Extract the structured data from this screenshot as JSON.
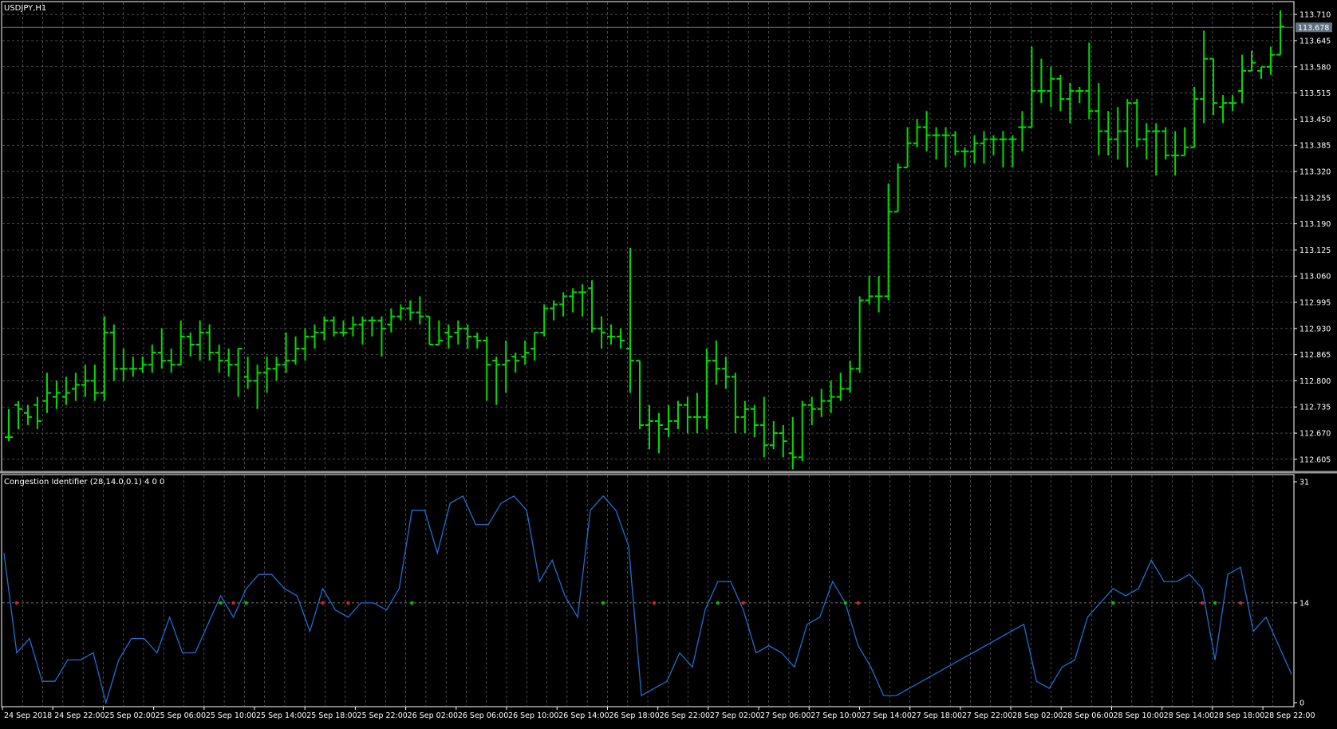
{
  "chart_data": [
    {
      "type": "ohlc",
      "title": "USDJPY,H1",
      "current_price": "113.678",
      "ylim": [
        112.575,
        113.74
      ],
      "y_ticks": [
        "113.710",
        "113.645",
        "113.580",
        "113.515",
        "113.450",
        "113.385",
        "113.320",
        "113.255",
        "113.190",
        "113.125",
        "113.060",
        "112.995",
        "112.930",
        "112.865",
        "112.800",
        "112.735",
        "112.670",
        "112.605"
      ],
      "colors": {
        "background": "#000000",
        "bars": "#00dd00",
        "grid": "#7a7a7a",
        "axis": "#ffffff",
        "price_line": "#607080"
      },
      "bars": [
        {
          "o": 112.66,
          "h": 112.73,
          "l": 112.65,
          "c": 112.66
        },
        {
          "o": 112.74,
          "h": 112.75,
          "l": 112.68,
          "c": 112.73
        },
        {
          "o": 112.72,
          "h": 112.74,
          "l": 112.69,
          "c": 112.71
        },
        {
          "o": 112.74,
          "h": 112.76,
          "l": 112.68,
          "c": 112.7
        },
        {
          "o": 112.75,
          "h": 112.82,
          "l": 112.72,
          "c": 112.77
        },
        {
          "o": 112.76,
          "h": 112.8,
          "l": 112.73,
          "c": 112.77
        },
        {
          "o": 112.76,
          "h": 112.81,
          "l": 112.74,
          "c": 112.77
        },
        {
          "o": 112.78,
          "h": 112.82,
          "l": 112.75,
          "c": 112.79
        },
        {
          "o": 112.79,
          "h": 112.84,
          "l": 112.76,
          "c": 112.8
        },
        {
          "o": 112.8,
          "h": 112.84,
          "l": 112.75,
          "c": 112.77
        },
        {
          "o": 112.77,
          "h": 112.96,
          "l": 112.75,
          "c": 112.92
        },
        {
          "o": 112.92,
          "h": 112.94,
          "l": 112.8,
          "c": 112.83
        },
        {
          "o": 112.83,
          "h": 112.88,
          "l": 112.8,
          "c": 112.83
        },
        {
          "o": 112.83,
          "h": 112.86,
          "l": 112.81,
          "c": 112.83
        },
        {
          "o": 112.83,
          "h": 112.86,
          "l": 112.82,
          "c": 112.84
        },
        {
          "o": 112.84,
          "h": 112.89,
          "l": 112.82,
          "c": 112.87
        },
        {
          "o": 112.87,
          "h": 112.93,
          "l": 112.83,
          "c": 112.85
        },
        {
          "o": 112.85,
          "h": 112.88,
          "l": 112.82,
          "c": 112.84
        },
        {
          "o": 112.84,
          "h": 112.95,
          "l": 112.84,
          "c": 112.91
        },
        {
          "o": 112.91,
          "h": 112.92,
          "l": 112.86,
          "c": 112.89
        },
        {
          "o": 112.89,
          "h": 112.95,
          "l": 112.85,
          "c": 112.92
        },
        {
          "o": 112.92,
          "h": 112.94,
          "l": 112.85,
          "c": 112.87
        },
        {
          "o": 112.87,
          "h": 112.89,
          "l": 112.82,
          "c": 112.85
        },
        {
          "o": 112.85,
          "h": 112.88,
          "l": 112.81,
          "c": 112.84
        },
        {
          "o": 112.84,
          "h": 112.88,
          "l": 112.76,
          "c": 112.88
        },
        {
          "o": 112.81,
          "h": 112.86,
          "l": 112.78,
          "c": 112.8
        },
        {
          "o": 112.8,
          "h": 112.84,
          "l": 112.73,
          "c": 112.82
        },
        {
          "o": 112.82,
          "h": 112.86,
          "l": 112.77,
          "c": 112.83
        },
        {
          "o": 112.83,
          "h": 112.86,
          "l": 112.8,
          "c": 112.84
        },
        {
          "o": 112.84,
          "h": 112.92,
          "l": 112.82,
          "c": 112.85
        },
        {
          "o": 112.85,
          "h": 112.91,
          "l": 112.84,
          "c": 112.88
        },
        {
          "o": 112.88,
          "h": 112.93,
          "l": 112.85,
          "c": 112.91
        },
        {
          "o": 112.91,
          "h": 112.94,
          "l": 112.88,
          "c": 112.92
        },
        {
          "o": 112.92,
          "h": 112.96,
          "l": 112.9,
          "c": 112.95
        },
        {
          "o": 112.95,
          "h": 112.96,
          "l": 112.91,
          "c": 112.92
        },
        {
          "o": 112.92,
          "h": 112.95,
          "l": 112.91,
          "c": 112.92
        },
        {
          "o": 112.93,
          "h": 112.96,
          "l": 112.91,
          "c": 112.94
        },
        {
          "o": 112.94,
          "h": 112.96,
          "l": 112.89,
          "c": 112.95
        },
        {
          "o": 112.95,
          "h": 112.96,
          "l": 112.91,
          "c": 112.95
        },
        {
          "o": 112.95,
          "h": 112.96,
          "l": 112.86,
          "c": 112.93
        },
        {
          "o": 112.94,
          "h": 112.98,
          "l": 112.92,
          "c": 112.96
        },
        {
          "o": 112.96,
          "h": 112.99,
          "l": 112.95,
          "c": 112.98
        },
        {
          "o": 112.98,
          "h": 113.0,
          "l": 112.95,
          "c": 112.97
        },
        {
          "o": 112.97,
          "h": 113.01,
          "l": 112.94,
          "c": 112.96
        },
        {
          "o": 112.96,
          "h": 112.96,
          "l": 112.89,
          "c": 112.89
        },
        {
          "o": 112.89,
          "h": 112.95,
          "l": 112.89,
          "c": 112.9
        },
        {
          "o": 112.92,
          "h": 112.94,
          "l": 112.88,
          "c": 112.91
        },
        {
          "o": 112.92,
          "h": 112.95,
          "l": 112.89,
          "c": 112.93
        },
        {
          "o": 112.93,
          "h": 112.94,
          "l": 112.88,
          "c": 112.91
        },
        {
          "o": 112.91,
          "h": 112.92,
          "l": 112.88,
          "c": 112.9
        },
        {
          "o": 112.9,
          "h": 112.91,
          "l": 112.75,
          "c": 112.84
        },
        {
          "o": 112.85,
          "h": 112.86,
          "l": 112.74,
          "c": 112.84
        },
        {
          "o": 112.84,
          "h": 112.9,
          "l": 112.77,
          "c": 112.85
        },
        {
          "o": 112.86,
          "h": 112.87,
          "l": 112.82,
          "c": 112.85
        },
        {
          "o": 112.86,
          "h": 112.9,
          "l": 112.84,
          "c": 112.87
        },
        {
          "o": 112.88,
          "h": 112.92,
          "l": 112.85,
          "c": 112.92
        },
        {
          "o": 112.92,
          "h": 112.99,
          "l": 112.91,
          "c": 112.98
        },
        {
          "o": 112.98,
          "h": 113.0,
          "l": 112.95,
          "c": 112.99
        },
        {
          "o": 112.99,
          "h": 113.02,
          "l": 112.96,
          "c": 113.01
        },
        {
          "o": 113.01,
          "h": 113.03,
          "l": 112.97,
          "c": 113.02
        },
        {
          "o": 113.02,
          "h": 113.04,
          "l": 112.96,
          "c": 113.02
        },
        {
          "o": 113.03,
          "h": 113.05,
          "l": 112.92,
          "c": 112.93
        },
        {
          "o": 112.93,
          "h": 112.96,
          "l": 112.88,
          "c": 112.92
        },
        {
          "o": 112.91,
          "h": 112.94,
          "l": 112.89,
          "c": 112.91
        },
        {
          "o": 112.91,
          "h": 112.93,
          "l": 112.88,
          "c": 112.9
        },
        {
          "o": 112.88,
          "h": 113.13,
          "l": 112.77,
          "c": 112.85
        },
        {
          "o": 112.85,
          "h": 112.85,
          "l": 112.68,
          "c": 112.69
        },
        {
          "o": 112.69,
          "h": 112.74,
          "l": 112.63,
          "c": 112.7
        },
        {
          "o": 112.7,
          "h": 112.72,
          "l": 112.62,
          "c": 112.69
        },
        {
          "o": 112.68,
          "h": 112.74,
          "l": 112.66,
          "c": 112.7
        },
        {
          "o": 112.7,
          "h": 112.75,
          "l": 112.68,
          "c": 112.74
        },
        {
          "o": 112.74,
          "h": 112.76,
          "l": 112.67,
          "c": 112.71
        },
        {
          "o": 112.71,
          "h": 112.77,
          "l": 112.67,
          "c": 112.71
        },
        {
          "o": 112.71,
          "h": 112.88,
          "l": 112.68,
          "c": 112.85
        },
        {
          "o": 112.85,
          "h": 112.9,
          "l": 112.79,
          "c": 112.83
        },
        {
          "o": 112.83,
          "h": 112.86,
          "l": 112.78,
          "c": 112.81
        },
        {
          "o": 112.81,
          "h": 112.82,
          "l": 112.67,
          "c": 112.71
        },
        {
          "o": 112.71,
          "h": 112.75,
          "l": 112.67,
          "c": 112.73
        },
        {
          "o": 112.73,
          "h": 112.74,
          "l": 112.66,
          "c": 112.69
        },
        {
          "o": 112.69,
          "h": 112.76,
          "l": 112.61,
          "c": 112.64
        },
        {
          "o": 112.64,
          "h": 112.7,
          "l": 112.63,
          "c": 112.67
        },
        {
          "o": 112.67,
          "h": 112.69,
          "l": 112.61,
          "c": 112.65
        },
        {
          "o": 112.62,
          "h": 112.71,
          "l": 112.58,
          "c": 112.61
        },
        {
          "o": 112.61,
          "h": 112.75,
          "l": 112.6,
          "c": 112.74
        },
        {
          "o": 112.74,
          "h": 112.76,
          "l": 112.69,
          "c": 112.73
        },
        {
          "o": 112.73,
          "h": 112.78,
          "l": 112.71,
          "c": 112.75
        },
        {
          "o": 112.75,
          "h": 112.8,
          "l": 112.72,
          "c": 112.76
        },
        {
          "o": 112.76,
          "h": 112.82,
          "l": 112.75,
          "c": 112.78
        },
        {
          "o": 112.78,
          "h": 112.85,
          "l": 112.77,
          "c": 112.83
        },
        {
          "o": 112.83,
          "h": 113.01,
          "l": 112.82,
          "c": 113.0
        },
        {
          "o": 113.0,
          "h": 113.06,
          "l": 112.99,
          "c": 113.01
        },
        {
          "o": 113.01,
          "h": 113.06,
          "l": 112.97,
          "c": 113.01
        },
        {
          "o": 113.01,
          "h": 113.29,
          "l": 113.0,
          "c": 113.22
        },
        {
          "o": 113.22,
          "h": 113.34,
          "l": 113.22,
          "c": 113.33
        },
        {
          "o": 113.33,
          "h": 113.43,
          "l": 113.33,
          "c": 113.39
        },
        {
          "o": 113.39,
          "h": 113.45,
          "l": 113.38,
          "c": 113.43
        },
        {
          "o": 113.43,
          "h": 113.47,
          "l": 113.37,
          "c": 113.41
        },
        {
          "o": 113.41,
          "h": 113.43,
          "l": 113.35,
          "c": 113.41
        },
        {
          "o": 113.41,
          "h": 113.43,
          "l": 113.33,
          "c": 113.41
        },
        {
          "o": 113.41,
          "h": 113.42,
          "l": 113.36,
          "c": 113.37
        },
        {
          "o": 113.37,
          "h": 113.38,
          "l": 113.33,
          "c": 113.37
        },
        {
          "o": 113.37,
          "h": 113.41,
          "l": 113.34,
          "c": 113.39
        },
        {
          "o": 113.39,
          "h": 113.42,
          "l": 113.34,
          "c": 113.4
        },
        {
          "o": 113.4,
          "h": 113.41,
          "l": 113.36,
          "c": 113.4
        },
        {
          "o": 113.4,
          "h": 113.42,
          "l": 113.33,
          "c": 113.4
        },
        {
          "o": 113.4,
          "h": 113.41,
          "l": 113.33,
          "c": 113.4
        },
        {
          "o": 113.43,
          "h": 113.47,
          "l": 113.37,
          "c": 113.43
        },
        {
          "o": 113.43,
          "h": 113.63,
          "l": 113.43,
          "c": 113.52
        },
        {
          "o": 113.52,
          "h": 113.6,
          "l": 113.49,
          "c": 113.52
        },
        {
          "o": 113.52,
          "h": 113.58,
          "l": 113.48,
          "c": 113.55
        },
        {
          "o": 113.55,
          "h": 113.56,
          "l": 113.47,
          "c": 113.5
        },
        {
          "o": 113.5,
          "h": 113.54,
          "l": 113.44,
          "c": 113.52
        },
        {
          "o": 113.52,
          "h": 113.53,
          "l": 113.49,
          "c": 113.52
        },
        {
          "o": 113.52,
          "h": 113.64,
          "l": 113.45,
          "c": 113.47
        },
        {
          "o": 113.47,
          "h": 113.54,
          "l": 113.36,
          "c": 113.42
        },
        {
          "o": 113.42,
          "h": 113.47,
          "l": 113.36,
          "c": 113.4
        },
        {
          "o": 113.4,
          "h": 113.48,
          "l": 113.35,
          "c": 113.42
        },
        {
          "o": 113.42,
          "h": 113.5,
          "l": 113.33,
          "c": 113.49
        },
        {
          "o": 113.49,
          "h": 113.5,
          "l": 113.38,
          "c": 113.4
        },
        {
          "o": 113.4,
          "h": 113.44,
          "l": 113.35,
          "c": 113.42
        },
        {
          "o": 113.42,
          "h": 113.44,
          "l": 113.31,
          "c": 113.42
        },
        {
          "o": 113.42,
          "h": 113.43,
          "l": 113.35,
          "c": 113.36
        },
        {
          "o": 113.36,
          "h": 113.42,
          "l": 113.31,
          "c": 113.36
        },
        {
          "o": 113.36,
          "h": 113.43,
          "l": 113.36,
          "c": 113.38
        },
        {
          "o": 113.38,
          "h": 113.53,
          "l": 113.38,
          "c": 113.5
        },
        {
          "o": 113.5,
          "h": 113.67,
          "l": 113.44,
          "c": 113.6
        },
        {
          "o": 113.6,
          "h": 113.6,
          "l": 113.46,
          "c": 113.49
        },
        {
          "o": 113.48,
          "h": 113.51,
          "l": 113.44,
          "c": 113.49
        },
        {
          "o": 113.49,
          "h": 113.51,
          "l": 113.47,
          "c": 113.49
        },
        {
          "o": 113.52,
          "h": 113.61,
          "l": 113.49,
          "c": 113.57
        },
        {
          "o": 113.57,
          "h": 113.62,
          "l": 113.57,
          "c": 113.59
        },
        {
          "o": 113.57,
          "h": 113.58,
          "l": 113.55,
          "c": 113.58
        },
        {
          "o": 113.58,
          "h": 113.63,
          "l": 113.56,
          "c": 113.61
        },
        {
          "o": 113.61,
          "h": 113.72,
          "l": 113.61,
          "c": 113.68
        }
      ]
    },
    {
      "type": "line",
      "title": "Congestion Identifier (28,14.0,0.1) 4 0 0",
      "ylim": [
        0,
        31
      ],
      "y_ticks": [
        "31",
        "14",
        "0"
      ],
      "level": 14,
      "colors": {
        "line": "#1e6fd0",
        "level": "#9a9a9a",
        "green_marker": "#00c000",
        "red_marker": "#e02020"
      },
      "values": [
        21,
        7,
        9,
        3,
        3,
        6,
        6,
        7,
        0,
        6,
        9,
        9,
        7,
        12,
        7,
        7,
        11,
        15,
        12,
        16,
        18,
        18,
        16,
        15,
        10,
        16,
        13,
        12,
        14,
        14,
        13,
        16,
        27,
        27,
        21,
        28,
        29,
        25,
        25,
        28,
        29,
        27,
        17,
        20,
        15,
        12,
        27,
        29,
        27,
        22,
        1,
        2,
        3,
        7,
        5,
        13,
        17,
        17,
        13,
        7,
        8,
        7,
        5,
        11,
        12,
        17,
        14,
        8,
        5,
        1,
        1,
        2,
        3,
        4,
        5,
        6,
        7,
        8,
        9,
        10,
        11,
        3,
        2,
        5,
        6,
        12,
        14,
        16,
        15,
        16,
        20,
        17,
        17,
        18,
        16,
        6,
        18,
        19,
        10,
        12,
        8,
        4
      ],
      "markers": [
        {
          "i": 1,
          "color": "red"
        },
        {
          "i": 17,
          "color": "green"
        },
        {
          "i": 18,
          "color": "red"
        },
        {
          "i": 19,
          "color": "green"
        },
        {
          "i": 25,
          "color": "red"
        },
        {
          "i": 27,
          "color": "red"
        },
        {
          "i": 32,
          "color": "green"
        },
        {
          "i": 47,
          "color": "green"
        },
        {
          "i": 51,
          "color": "red"
        },
        {
          "i": 56,
          "color": "green"
        },
        {
          "i": 58,
          "color": "red"
        },
        {
          "i": 66,
          "color": "green"
        },
        {
          "i": 67,
          "color": "red"
        },
        {
          "i": 87,
          "color": "green"
        },
        {
          "i": 94,
          "color": "red"
        },
        {
          "i": 95,
          "color": "green"
        },
        {
          "i": 97,
          "color": "red"
        }
      ]
    }
  ],
  "x_axis": {
    "tick_labels": [
      "24 Sep 2018",
      "24 Sep 22:00",
      "25 Sep 02:00",
      "25 Sep 06:00",
      "25 Sep 10:00",
      "25 Sep 14:00",
      "25 Sep 18:00",
      "25 Sep 22:00",
      "26 Sep 02:00",
      "26 Sep 06:00",
      "26 Sep 10:00",
      "26 Sep 14:00",
      "26 Sep 18:00",
      "26 Sep 22:00",
      "27 Sep 02:00",
      "27 Sep 06:00",
      "27 Sep 10:00",
      "27 Sep 14:00",
      "27 Sep 18:00",
      "27 Sep 22:00",
      "28 Sep 02:00",
      "28 Sep 06:00",
      "28 Sep 10:00",
      "28 Sep 14:00",
      "28 Sep 18:00",
      "28 Sep 22:00"
    ]
  }
}
